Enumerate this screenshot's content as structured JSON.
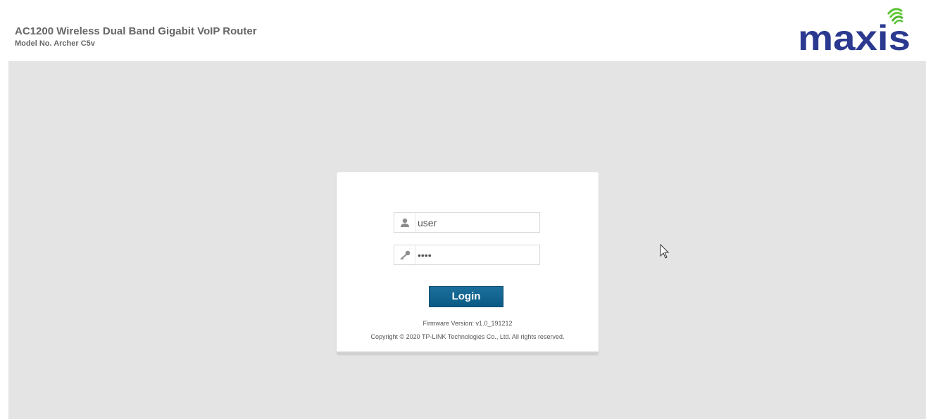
{
  "header": {
    "product_title": "AC1200 Wireless Dual Band Gigabit VoIP Router",
    "model_number": "Model No. Archer C5v",
    "logo_text": "maxis"
  },
  "login": {
    "username_value": "user",
    "password_value": "1234",
    "login_button_label": "Login",
    "firmware_version": "Firmware Version: v1.0_191212",
    "copyright": "Copyright © 2020 TP-LINK Technologies Co., Ltd. All rights reserved."
  },
  "icons": {
    "username_icon": "user-icon",
    "password_icon": "key-icon"
  },
  "colors": {
    "page_background": "#e4e4e4",
    "header_text": "#666666",
    "login_button": "#0b5a86",
    "logo_blue": "#2b3990",
    "logo_green": "#5bc236"
  }
}
